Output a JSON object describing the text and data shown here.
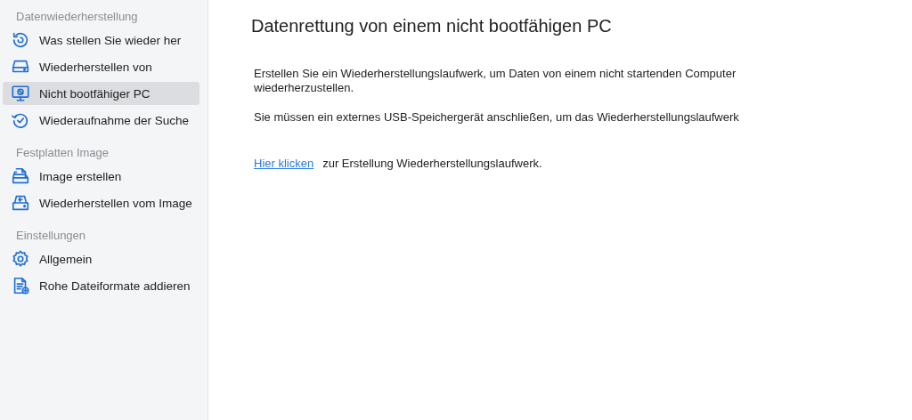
{
  "sidebar": {
    "sections": [
      {
        "heading": "Datenwiederherstellung",
        "items": [
          {
            "label": "Was stellen Sie wieder her",
            "selected": false
          },
          {
            "label": "Wiederherstellen von",
            "selected": false
          },
          {
            "label": "Nicht bootfähiger PC",
            "selected": true
          },
          {
            "label": "Wiederaufnahme der Suche",
            "selected": false
          }
        ]
      },
      {
        "heading": "Festplatten Image",
        "items": [
          {
            "label": "Image erstellen",
            "selected": false
          },
          {
            "label": "Wiederherstellen vom Image",
            "selected": false
          }
        ]
      },
      {
        "heading": "Einstellungen",
        "items": [
          {
            "label": "Allgemein",
            "selected": false
          },
          {
            "label": "Rohe Dateiformate addieren",
            "selected": false
          }
        ]
      }
    ]
  },
  "main": {
    "title": "Datenrettung von einem nicht bootfähigen PC",
    "paragraphs": [
      "Erstellen Sie ein Wiederherstellungslaufwerk, um Daten von einem nicht startenden Computer wiederherzustellen.",
      "Sie müssen ein externes USB-Speichergerät anschließen, um das Wiederherstellungslaufwerk"
    ],
    "link": "Hier klicken",
    "link_text": "zur Erstellung Wiederherstellungslaufwerk."
  }
}
